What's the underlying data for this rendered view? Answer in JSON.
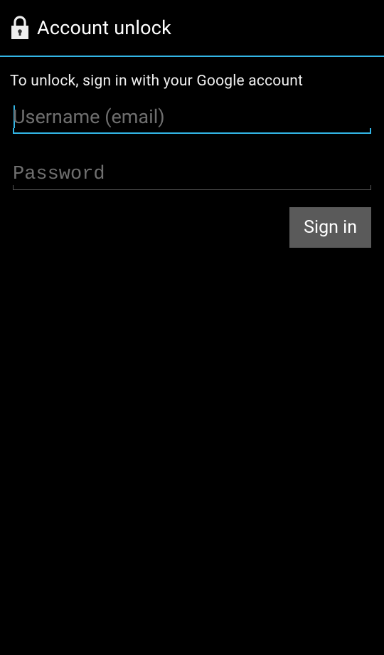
{
  "header": {
    "title": "Account unlock",
    "icon": "lock-icon"
  },
  "content": {
    "instructions": "To unlock, sign in with your Google account",
    "username": {
      "placeholder": "Username (email)",
      "value": ""
    },
    "password": {
      "placeholder": "Password",
      "value": ""
    },
    "signin_label": "Sign in"
  },
  "colors": {
    "accent": "#33b5e5",
    "background": "#000000",
    "button": "#5a5a5a"
  }
}
